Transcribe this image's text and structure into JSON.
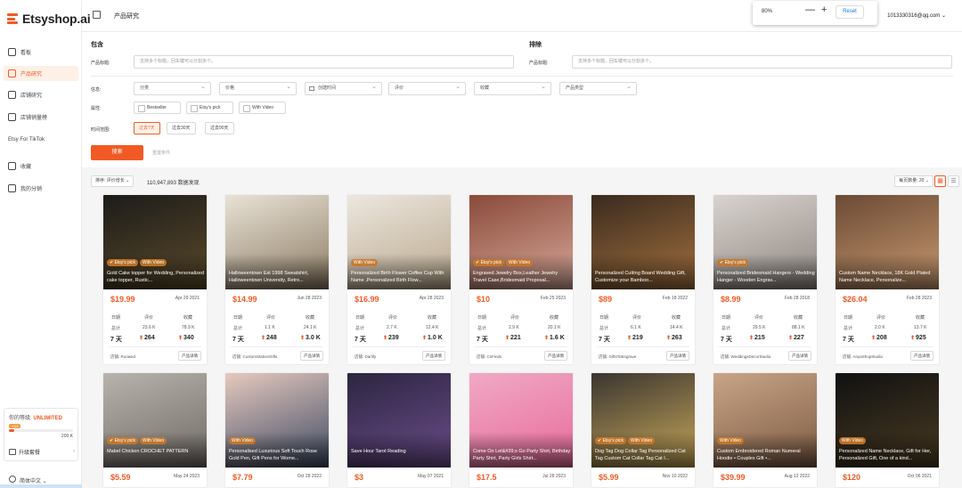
{
  "app": {
    "logo": "Etsyshop.ai",
    "page_title": "产品研究"
  },
  "zoom": {
    "value": "80%",
    "minus": "—",
    "plus": "+",
    "reset": "Reset"
  },
  "user": {
    "email": "1013330316@qq.com",
    "caret": "⌄"
  },
  "sidebar": {
    "items": [
      {
        "label": "看板",
        "icon": "home-icon",
        "active": false
      },
      {
        "label": "产品研究",
        "icon": "product-icon",
        "active": true
      },
      {
        "label": "店铺研究",
        "icon": "shop-icon",
        "active": false
      },
      {
        "label": "店铺销量榜",
        "icon": "ranking-icon",
        "active": false
      },
      {
        "label": "Etsy For TikTok",
        "icon": "",
        "active": false
      },
      {
        "label": "收藏",
        "icon": "star-icon",
        "active": false
      },
      {
        "label": "我的分销",
        "icon": "money-icon",
        "active": false
      }
    ],
    "plan": {
      "label": "你的等级:",
      "level": "UNLIMITED",
      "used": "1022",
      "max": "200 K",
      "used_fraction": 0.08,
      "upgrade": "升级套餐"
    },
    "language": "简体中文"
  },
  "filters": {
    "include_label": "包含",
    "exclude_label": "排除",
    "product_title_label": "产品标题:",
    "include_placeholder": "支持多个标题，回车键可以分割多个。",
    "exclude_placeholder": "支持多个标题，回车键可以分割多个。",
    "info_label": "信息:",
    "dropdowns": [
      "分类",
      "价格",
      "创建时间",
      "评价",
      "收藏",
      "产品类型"
    ],
    "attr_label": "属性:",
    "attributes": [
      "Bestseller",
      "Etsy's pick",
      "With Video"
    ],
    "time_label": "时间范围:",
    "time_ranges": [
      {
        "label": "过去7天",
        "active": true
      },
      {
        "label": "过去30天",
        "active": false
      },
      {
        "label": "过去90天",
        "active": false
      }
    ],
    "search_button": "搜索",
    "reset_button": "重置条件"
  },
  "results": {
    "sort": "排序: 评价增长",
    "sort_caret": "⌄",
    "count": "110,947,893 数据发现",
    "per_page": "每页数量: 20",
    "stat_headers": [
      "日期",
      "评价",
      "收藏"
    ],
    "row_total": "总计",
    "row_week": "7 天",
    "shop_prefix": "店铺:",
    "detail_button": "产品详情",
    "cards": [
      {
        "title": "Gold Cake topper for Wedding, Personalized cake topper, Rustic...",
        "badges": [
          "Etsy's pick",
          "With Video"
        ],
        "price": "$19.99",
        "date": "Apr 29 2021",
        "reviews_total": "23.6 K",
        "favs_total": "78.9 K",
        "reviews_7d": "264",
        "favs_7d": "340",
        "shop": "Roowed",
        "color1": "#1d1c1a",
        "color2": "#5a4a2a"
      },
      {
        "title": "Halloweentown Est 1998 Sweatshirt, Halloweentown University, Retro...",
        "badges": [],
        "price": "$14.99",
        "date": "Jun 28 2023",
        "reviews_total": "1.1 K",
        "favs_total": "24.1 K",
        "reviews_7d": "248",
        "favs_7d": "3.0 K",
        "shop": "CustomStationGifts",
        "color1": "#e8e2d6",
        "color2": "#8c7b63"
      },
      {
        "title": "Personalized Birth Flower Coffee Cup With Name ,Personalized Birth Flow...",
        "badges": [
          "With Video"
        ],
        "price": "$16.99",
        "date": "Apr 28 2023",
        "reviews_total": "2.7 K",
        "favs_total": "12.4 K",
        "reviews_7d": "239",
        "favs_7d": "1.0 K",
        "shop": "Darlify",
        "color1": "#ece7df",
        "color2": "#b9a78c"
      },
      {
        "title": "Engraved Jewelry Box,Leather Jewelry Travel Case,Bridesmaid Proposal...",
        "badges": [
          "Etsy's pick",
          "With Video"
        ],
        "price": "$10",
        "date": "Feb 25 2023",
        "reviews_total": "2.9 K",
        "favs_total": "20.1 K",
        "reviews_7d": "221",
        "favs_7d": "1.6 K",
        "shop": "CnFinds",
        "color1": "#8a4a3a",
        "color2": "#d7a99a"
      },
      {
        "title": "Personalized Cutting Board Wedding Gift, Customize your Bamboo...",
        "badges": [],
        "price": "$89",
        "date": "Feb 18 2022",
        "reviews_total": "6.1 K",
        "favs_total": "14.4 K",
        "reviews_7d": "219",
        "favs_7d": "263",
        "shop": "GiftsToEngrave",
        "color1": "#3a2a1e",
        "color2": "#a4723f"
      },
      {
        "title": "Personalized Bridesmaid Hangers - Wedding Hanger - Wooden Engrav...",
        "badges": [
          "Etsy's pick"
        ],
        "price": "$8.99",
        "date": "Feb 28 2018",
        "reviews_total": "29.5 K",
        "favs_total": "88.1 K",
        "reviews_7d": "215",
        "favs_7d": "227",
        "shop": "WeddingsDecorStudio",
        "color1": "#d9d3cf",
        "color2": "#8e8680"
      },
      {
        "title": "Custom Name Necklace, 18K Gold Plated Name Necklace, Personalize...",
        "badges": [],
        "price": "$26.04",
        "date": "Feb 28 2023",
        "reviews_total": "2.0 K",
        "favs_total": "13.7 K",
        "reviews_7d": "208",
        "favs_7d": "925",
        "shop": "AnyaShopStudio",
        "color1": "#6b4a35",
        "color2": "#c99a70"
      },
      {
        "title": "Mabel Chicken CROCHET PATTERN",
        "badges": [
          "Etsy's pick",
          "With Video"
        ],
        "price": "$5.59",
        "date": "May 24 2023",
        "color1": "#b9b3ad",
        "color2": "#6f6a64"
      },
      {
        "title": "Personalised Luxurious Soft Touch Rose Gold Pen, Gift Pens for Wome...",
        "badges": [
          "With Video"
        ],
        "price": "$7.79",
        "date": "Oct 28 2022",
        "color1": "#e6c9be",
        "color2": "#3d4a63"
      },
      {
        "title": "Save Hour Tarot Reading",
        "badges": [],
        "price": "$3",
        "date": "May 07 2021",
        "color1": "#2c2540",
        "color2": "#6c4e8c"
      },
      {
        "title": "Come On Let&#39;s Go Party Shirt, Birthday Party Shirt, Party Girls Shirt...",
        "badges": [],
        "price": "$17.5",
        "date": "Jul 28 2023",
        "color1": "#f0a9c4",
        "color2": "#e86b9a"
      },
      {
        "title": "Dog Tag Dog Collar Tag Personalized Cat Tag Custom Cat Collar Tag Cat I...",
        "badges": [
          "Etsy's pick",
          "With Video"
        ],
        "price": "$5.99",
        "date": "Nov 10 2022",
        "color1": "#3a3530",
        "color2": "#c8a85a"
      },
      {
        "title": "Custom Embroidered Roman Numeral Hoodie • Couples Gift •...",
        "badges": [
          "With Video"
        ],
        "price": "$39.99",
        "date": "Aug 12 2022",
        "color1": "#c8a587",
        "color2": "#7c5a42"
      },
      {
        "title": "Personalized Name Necklace, Gift for Her, Personalized Gift, One of a kind...",
        "badges": [
          "With Video"
        ],
        "price": "$120",
        "date": "Oct 06 2021",
        "color1": "#111111",
        "color2": "#4a3b22"
      }
    ]
  }
}
